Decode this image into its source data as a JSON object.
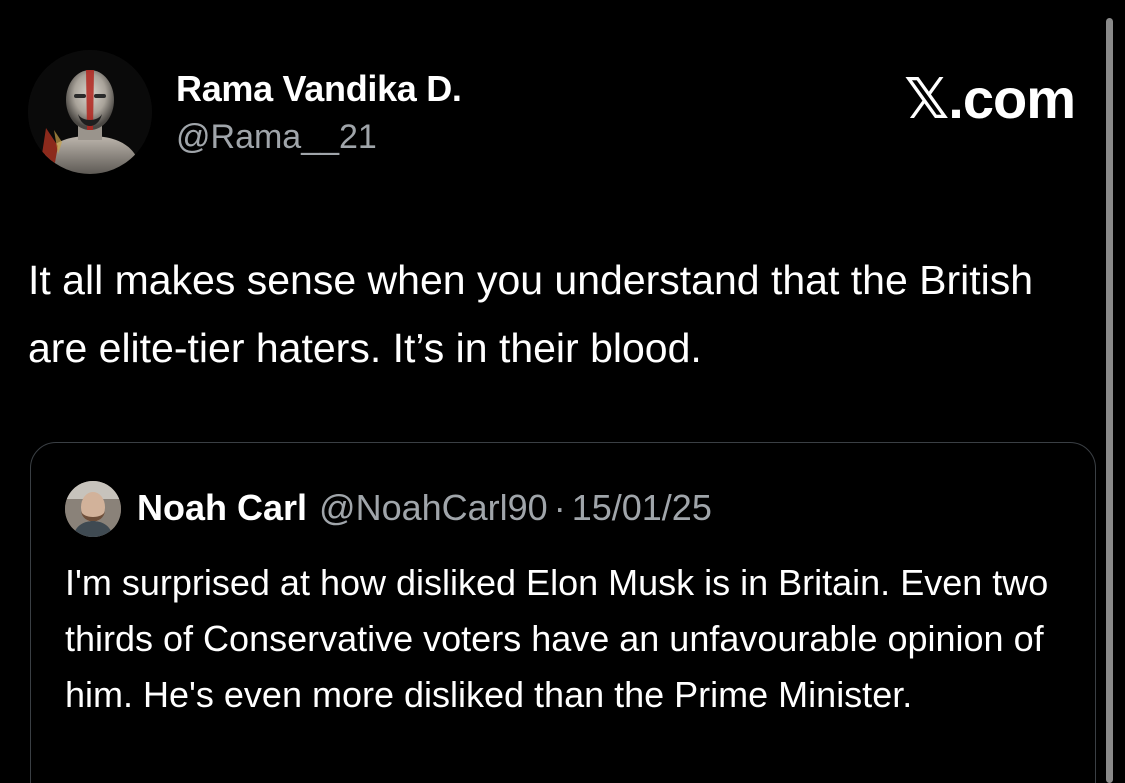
{
  "tweet": {
    "author": {
      "display_name": "Rama Vandika D.",
      "handle": "@Rama__21"
    },
    "brand": "𝕏.com",
    "text": "It all makes sense when you understand that the British are elite-tier haters. It’s in their blood."
  },
  "quoted_tweet": {
    "author": {
      "display_name": "Noah Carl",
      "handle": "@NoahCarl90"
    },
    "separator": "·",
    "date": "15/01/25",
    "text": "I'm surprised at how disliked Elon Musk is in Britain. Even two thirds of Conservative voters have an unfavourable opinion of him. He's even more disliked than the Prime Minister."
  },
  "colors": {
    "background": "#000000",
    "primary_text": "#ffffff",
    "secondary_text": "#a0a5aa",
    "card_border": "#3a3f44"
  }
}
